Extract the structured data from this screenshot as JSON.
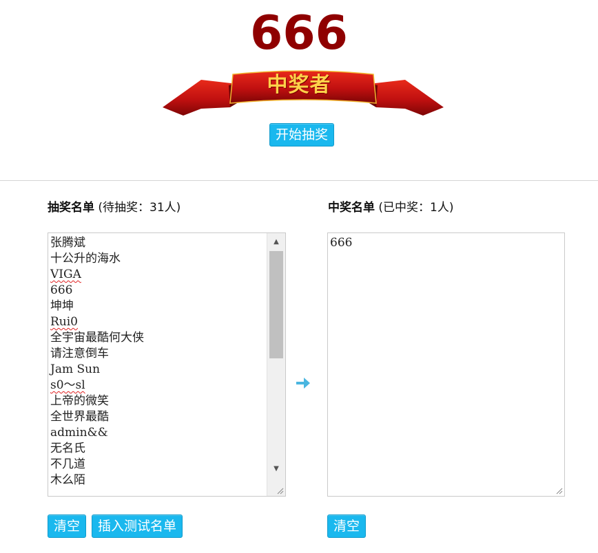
{
  "current_display": "666",
  "banner": {
    "text": "中奖者"
  },
  "start_button": "开始抽奖",
  "candidates": {
    "title": "抽奖名单",
    "subtitle": "(待抽奖：31人)",
    "names": [
      "张腾斌",
      "十公升的海水",
      "VIGA",
      "666",
      "坤坤",
      "Rui0",
      "全宇宙最酷何大侠",
      "请注意倒车",
      "Jam Sun",
      "s0～sl",
      "上帝的微笑",
      "全世界最酷",
      "admin&&",
      "无名氏",
      "不几道",
      "木么陌"
    ],
    "clear_button": "清空",
    "insert_test_button": "插入测试名单"
  },
  "winners": {
    "title": "中奖名单",
    "subtitle": "(已中奖：1人)",
    "names": [
      "666"
    ],
    "clear_button": "清空"
  },
  "colors": {
    "accent": "#1ab8ee",
    "display_red": "#8f0000",
    "arrow": "#4ab6e0",
    "banner_red": "#c81010"
  },
  "icons": {
    "transfer_arrow": "arrow-right-icon"
  }
}
